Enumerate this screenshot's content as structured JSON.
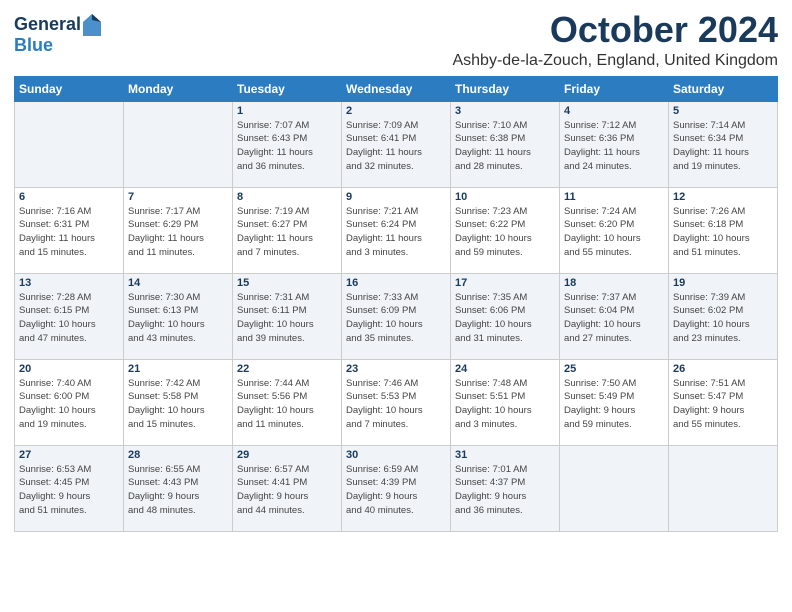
{
  "logo": {
    "line1": "General",
    "line2": "Blue"
  },
  "title": "October 2024",
  "subtitle": "Ashby-de-la-Zouch, England, United Kingdom",
  "days_header": [
    "Sunday",
    "Monday",
    "Tuesday",
    "Wednesday",
    "Thursday",
    "Friday",
    "Saturday"
  ],
  "weeks": [
    [
      {
        "day": "",
        "info": ""
      },
      {
        "day": "",
        "info": ""
      },
      {
        "day": "1",
        "info": "Sunrise: 7:07 AM\nSunset: 6:43 PM\nDaylight: 11 hours\nand 36 minutes."
      },
      {
        "day": "2",
        "info": "Sunrise: 7:09 AM\nSunset: 6:41 PM\nDaylight: 11 hours\nand 32 minutes."
      },
      {
        "day": "3",
        "info": "Sunrise: 7:10 AM\nSunset: 6:38 PM\nDaylight: 11 hours\nand 28 minutes."
      },
      {
        "day": "4",
        "info": "Sunrise: 7:12 AM\nSunset: 6:36 PM\nDaylight: 11 hours\nand 24 minutes."
      },
      {
        "day": "5",
        "info": "Sunrise: 7:14 AM\nSunset: 6:34 PM\nDaylight: 11 hours\nand 19 minutes."
      }
    ],
    [
      {
        "day": "6",
        "info": "Sunrise: 7:16 AM\nSunset: 6:31 PM\nDaylight: 11 hours\nand 15 minutes."
      },
      {
        "day": "7",
        "info": "Sunrise: 7:17 AM\nSunset: 6:29 PM\nDaylight: 11 hours\nand 11 minutes."
      },
      {
        "day": "8",
        "info": "Sunrise: 7:19 AM\nSunset: 6:27 PM\nDaylight: 11 hours\nand 7 minutes."
      },
      {
        "day": "9",
        "info": "Sunrise: 7:21 AM\nSunset: 6:24 PM\nDaylight: 11 hours\nand 3 minutes."
      },
      {
        "day": "10",
        "info": "Sunrise: 7:23 AM\nSunset: 6:22 PM\nDaylight: 10 hours\nand 59 minutes."
      },
      {
        "day": "11",
        "info": "Sunrise: 7:24 AM\nSunset: 6:20 PM\nDaylight: 10 hours\nand 55 minutes."
      },
      {
        "day": "12",
        "info": "Sunrise: 7:26 AM\nSunset: 6:18 PM\nDaylight: 10 hours\nand 51 minutes."
      }
    ],
    [
      {
        "day": "13",
        "info": "Sunrise: 7:28 AM\nSunset: 6:15 PM\nDaylight: 10 hours\nand 47 minutes."
      },
      {
        "day": "14",
        "info": "Sunrise: 7:30 AM\nSunset: 6:13 PM\nDaylight: 10 hours\nand 43 minutes."
      },
      {
        "day": "15",
        "info": "Sunrise: 7:31 AM\nSunset: 6:11 PM\nDaylight: 10 hours\nand 39 minutes."
      },
      {
        "day": "16",
        "info": "Sunrise: 7:33 AM\nSunset: 6:09 PM\nDaylight: 10 hours\nand 35 minutes."
      },
      {
        "day": "17",
        "info": "Sunrise: 7:35 AM\nSunset: 6:06 PM\nDaylight: 10 hours\nand 31 minutes."
      },
      {
        "day": "18",
        "info": "Sunrise: 7:37 AM\nSunset: 6:04 PM\nDaylight: 10 hours\nand 27 minutes."
      },
      {
        "day": "19",
        "info": "Sunrise: 7:39 AM\nSunset: 6:02 PM\nDaylight: 10 hours\nand 23 minutes."
      }
    ],
    [
      {
        "day": "20",
        "info": "Sunrise: 7:40 AM\nSunset: 6:00 PM\nDaylight: 10 hours\nand 19 minutes."
      },
      {
        "day": "21",
        "info": "Sunrise: 7:42 AM\nSunset: 5:58 PM\nDaylight: 10 hours\nand 15 minutes."
      },
      {
        "day": "22",
        "info": "Sunrise: 7:44 AM\nSunset: 5:56 PM\nDaylight: 10 hours\nand 11 minutes."
      },
      {
        "day": "23",
        "info": "Sunrise: 7:46 AM\nSunset: 5:53 PM\nDaylight: 10 hours\nand 7 minutes."
      },
      {
        "day": "24",
        "info": "Sunrise: 7:48 AM\nSunset: 5:51 PM\nDaylight: 10 hours\nand 3 minutes."
      },
      {
        "day": "25",
        "info": "Sunrise: 7:50 AM\nSunset: 5:49 PM\nDaylight: 9 hours\nand 59 minutes."
      },
      {
        "day": "26",
        "info": "Sunrise: 7:51 AM\nSunset: 5:47 PM\nDaylight: 9 hours\nand 55 minutes."
      }
    ],
    [
      {
        "day": "27",
        "info": "Sunrise: 6:53 AM\nSunset: 4:45 PM\nDaylight: 9 hours\nand 51 minutes."
      },
      {
        "day": "28",
        "info": "Sunrise: 6:55 AM\nSunset: 4:43 PM\nDaylight: 9 hours\nand 48 minutes."
      },
      {
        "day": "29",
        "info": "Sunrise: 6:57 AM\nSunset: 4:41 PM\nDaylight: 9 hours\nand 44 minutes."
      },
      {
        "day": "30",
        "info": "Sunrise: 6:59 AM\nSunset: 4:39 PM\nDaylight: 9 hours\nand 40 minutes."
      },
      {
        "day": "31",
        "info": "Sunrise: 7:01 AM\nSunset: 4:37 PM\nDaylight: 9 hours\nand 36 minutes."
      },
      {
        "day": "",
        "info": ""
      },
      {
        "day": "",
        "info": ""
      }
    ]
  ]
}
